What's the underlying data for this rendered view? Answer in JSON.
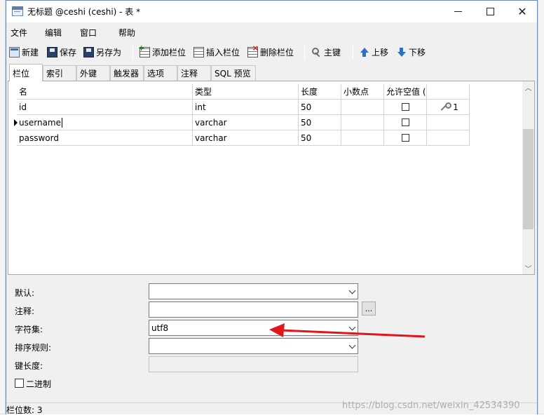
{
  "window": {
    "title": "无标题 @ceshi (ceshi) - 表 *"
  },
  "menu": [
    "文件",
    "编辑",
    "窗口",
    "帮助"
  ],
  "toolbar": {
    "new": "新建",
    "save": "保存",
    "save_as": "另存为",
    "add_field": "添加栏位",
    "insert_field": "插入栏位",
    "delete_field": "删除栏位",
    "primary_key": "主键",
    "move_up": "上移",
    "move_down": "下移"
  },
  "tabs": [
    "栏位",
    "索引",
    "外键",
    "触发器",
    "选项",
    "注释",
    "SQL 预览"
  ],
  "active_tab": "栏位",
  "grid": {
    "columns": [
      "名",
      "类型",
      "长度",
      "小数点",
      "允许空值 (",
      ""
    ],
    "rows": [
      {
        "name": "id",
        "type": "int",
        "length": "50",
        "decimals": "",
        "allow_null": false,
        "key": "1",
        "current": false
      },
      {
        "name": "username",
        "type": "varchar",
        "length": "50",
        "decimals": "",
        "allow_null": false,
        "key": "",
        "current": true
      },
      {
        "name": "password",
        "type": "varchar",
        "length": "50",
        "decimals": "",
        "allow_null": false,
        "key": "",
        "current": false
      }
    ]
  },
  "properties": {
    "default_label": "默认:",
    "default_value": "",
    "comment_label": "注释:",
    "comment_value": "",
    "comment_button": "...",
    "charset_label": "字符集:",
    "charset_value": "utf8",
    "collation_label": "排序规则:",
    "collation_value": "",
    "key_length_label": "键长度:",
    "key_length_value": "",
    "binary_label": "二进制",
    "binary_checked": false
  },
  "status": {
    "field_count": "栏位数: 3"
  },
  "watermark": "https://blog.csdn.net/weixin_42534390",
  "colors": {
    "annotation_arrow": "#e0161b",
    "window_border": "#6c8bb8"
  }
}
